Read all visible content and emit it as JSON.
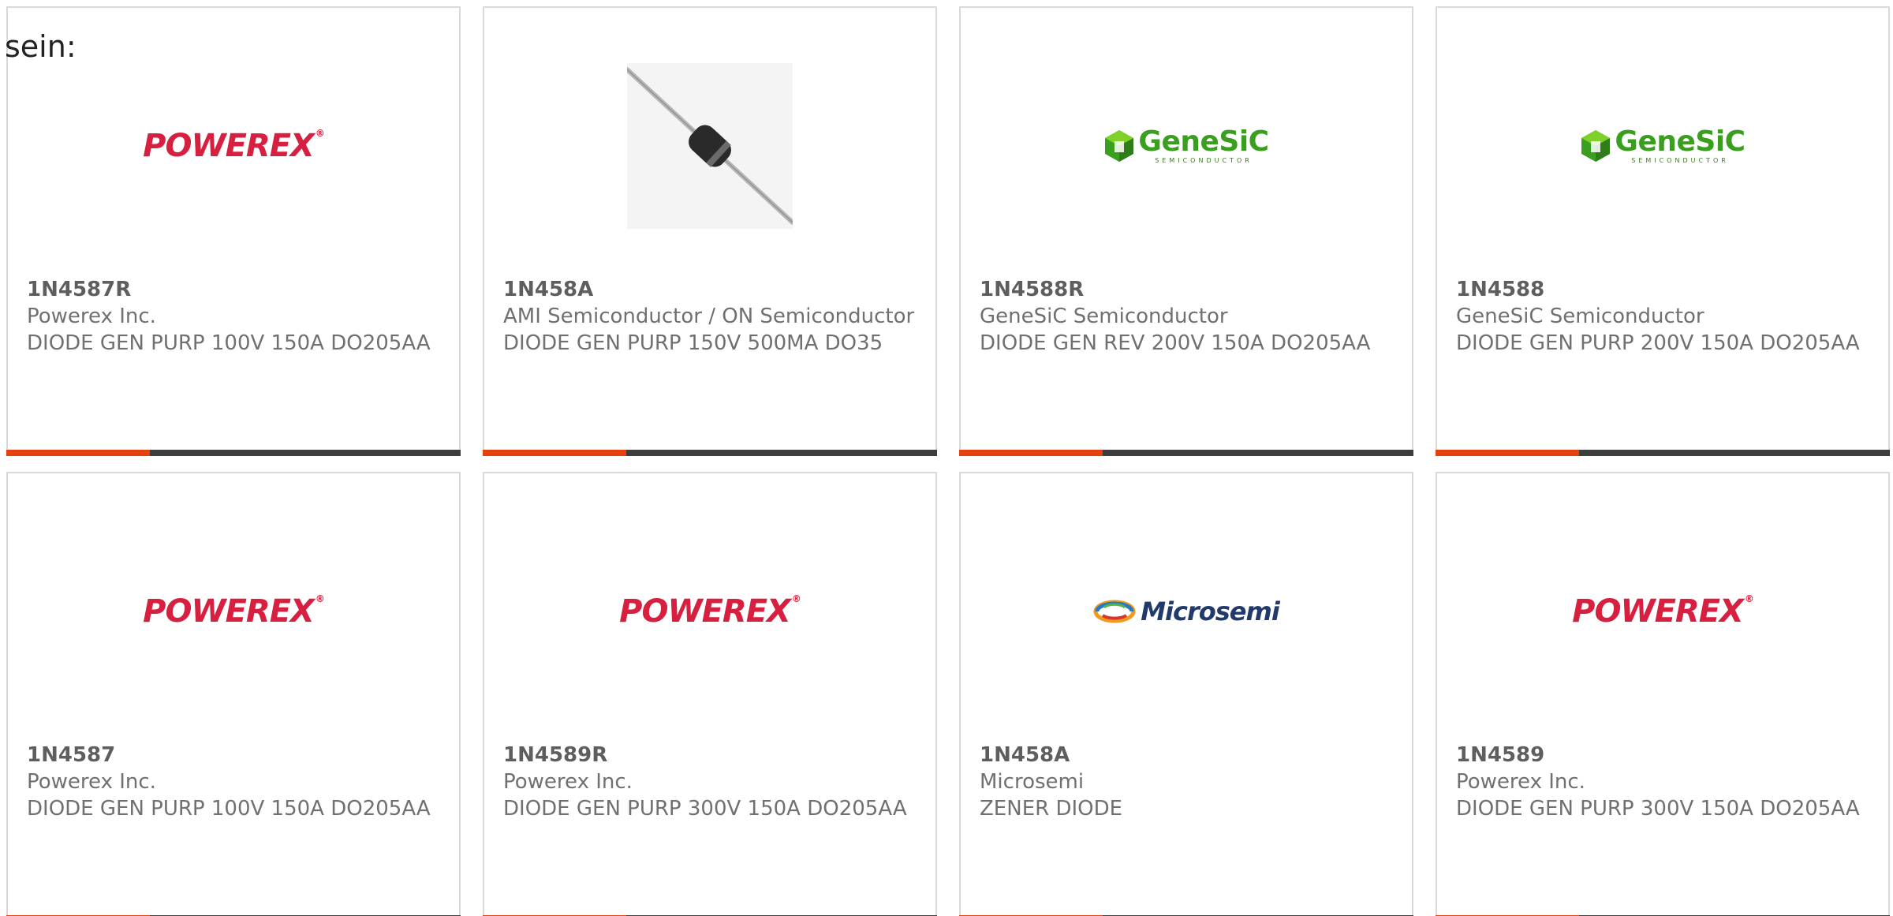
{
  "intro": {
    "text": "sein:"
  },
  "cards": [
    {
      "part": "1N4587R",
      "manufacturer": "Powerex Inc.",
      "description": "DIODE GEN PURP 100V 150A DO205AA",
      "image": "powerex-logo",
      "logo_text": "POWEREX",
      "logo_reg": "®"
    },
    {
      "part": "1N458A",
      "manufacturer": "AMI Semiconductor / ON Semiconductor",
      "description": "DIODE GEN PURP 150V 500MA DO35",
      "image": "axial-diode-photo"
    },
    {
      "part": "1N4588R",
      "manufacturer": "GeneSiC Semiconductor",
      "description": "DIODE GEN REV 200V 150A DO205AA",
      "image": "genesic-logo",
      "logo_text": "GeneSiC",
      "logo_sub": "SEMICONDUCTOR"
    },
    {
      "part": "1N4588",
      "manufacturer": "GeneSiC Semiconductor",
      "description": "DIODE GEN PURP 200V 150A DO205AA",
      "image": "genesic-logo",
      "logo_text": "GeneSiC",
      "logo_sub": "SEMICONDUCTOR"
    },
    {
      "part": "1N4587",
      "manufacturer": "Powerex Inc.",
      "description": "DIODE GEN PURP 100V 150A DO205AA",
      "image": "powerex-logo",
      "logo_text": "POWEREX",
      "logo_reg": "®"
    },
    {
      "part": "1N4589R",
      "manufacturer": "Powerex Inc.",
      "description": "DIODE GEN PURP 300V 150A DO205AA",
      "image": "powerex-logo",
      "logo_text": "POWEREX",
      "logo_reg": "®"
    },
    {
      "part": "1N458A",
      "manufacturer": "Microsemi",
      "description": "ZENER DIODE",
      "image": "microsemi-logo",
      "logo_text": "Microsemi"
    },
    {
      "part": "1N4589",
      "manufacturer": "Powerex Inc.",
      "description": "DIODE GEN PURP 300V 150A DO205AA",
      "image": "powerex-logo",
      "logo_text": "POWEREX",
      "logo_reg": "®"
    }
  ],
  "colors": {
    "accent": "#e8400c",
    "bar": "#3c3c3c",
    "border": "#d9d9d9",
    "text": "#707070",
    "powerex_red": "#d71f3f",
    "genesic_green": "#3a9e1e",
    "microsemi_blue": "#1f3a6b"
  }
}
